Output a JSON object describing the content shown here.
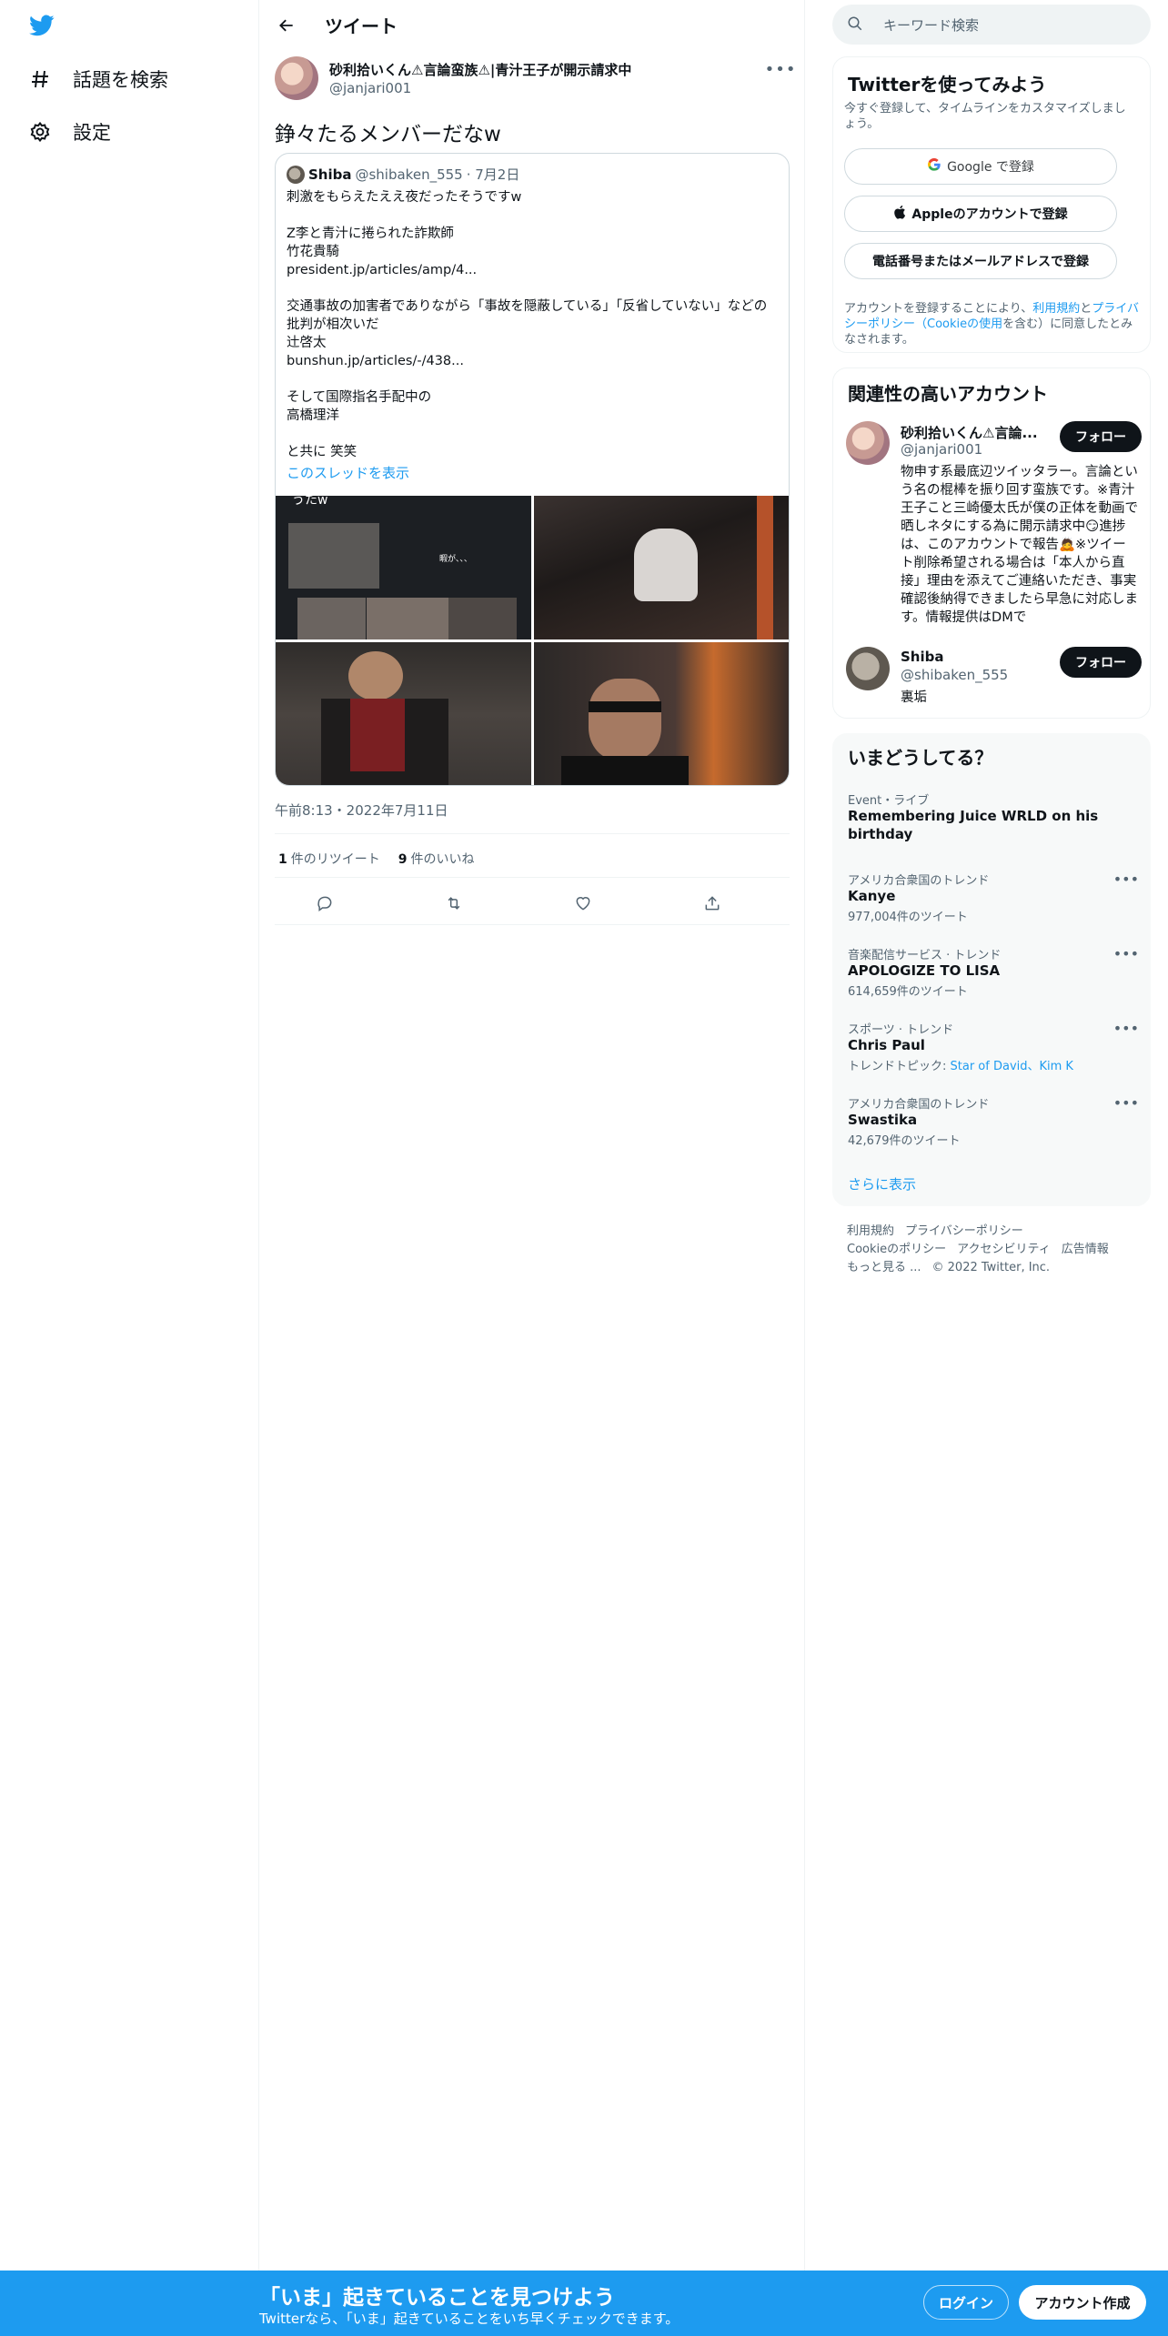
{
  "nav": {
    "items": [
      {
        "label": "話題を検索",
        "icon": "hashtag-icon"
      },
      {
        "label": "設定",
        "icon": "gear-icon"
      }
    ]
  },
  "header": {
    "title": "ツイート"
  },
  "tweet": {
    "author_name": "砂利拾いくん⚠言論蛮族⚠|青汁王子が開示請求中",
    "author_handle": "@janjari001",
    "text": "錚々たるメンバーだなw",
    "timestamp": "午前8:13・2022年7月11日",
    "retweets_count": "1",
    "retweets_label": "件のリツイート",
    "likes_count": "9",
    "likes_label": "件のいいね"
  },
  "quote": {
    "name": "Shiba",
    "handle": "@shibaken_555",
    "date": "· 7月2日",
    "lines": [
      "刺激をもらえたええ夜だったそうですw",
      "",
      "Z李と青汁に捲られた詐欺師",
      "竹花貴騎",
      "president.jp/articles/amp/4...",
      "",
      "交通事故の加害者でありながら「事故を隠蔽している」「反省していない」などの批判が相次いだ",
      "辻啓太",
      "bunshun.jp/articles/-/438...",
      "",
      "そして国際指名手配中の",
      "高橋理洋",
      "",
      "と共に 笑笑"
    ],
    "show_thread": "このスレッドを表示",
    "image1_caption": "うたw",
    "image1_inner": "暇が、、、"
  },
  "search": {
    "placeholder": "キーワード検索"
  },
  "signup_card": {
    "title": "Twitterを使ってみよう",
    "subtitle": "今すぐ登録して、タイムラインをカスタマイズしましょう。",
    "google": "Google で登録",
    "apple": "Appleのアカウントで登録",
    "phone": "電話番号またはメールアドレスで登録",
    "terms_pre": "アカウントを登録することにより、",
    "terms_link1": "利用規約",
    "terms_mid": "と",
    "terms_link2": "プライバシーポリシー（Cookieの使用",
    "terms_post": "を含む）に同意したとみなされます。"
  },
  "related": {
    "title": "関連性の高いアカウント",
    "follow_label": "フォロー",
    "accounts": [
      {
        "name": "砂利拾いくん⚠言論...",
        "handle": "@janjari001",
        "bio": "物申す系最底辺ツイッタラー。言論という名の棍棒を振り回す蛮族です。※青汁王子こと三崎優太氏が僕の正体を動画で晒しネタにする為に開示請求中😏進捗は、このアカウントで報告🙇※ツイート削除希望される場合は「本人から直接」理由を添えてご連絡いただき、事実確認後納得できましたら早急に対応します。情報提供はDMで"
      },
      {
        "name": "Shiba",
        "handle": "@shibaken_555",
        "bio": "裏垢"
      }
    ]
  },
  "trends": {
    "title": "いまどうしてる？",
    "items": [
      {
        "category": "Event・ライブ",
        "name": "Remembering Juice WRLD on his birthday",
        "count": ""
      },
      {
        "category": "アメリカ合衆国のトレンド",
        "name": "Kanye",
        "count": "977,004件のツイート"
      },
      {
        "category": "音楽配信サービス · トレンド",
        "name": "APOLOGIZE TO LISA",
        "count": "614,659件のツイート"
      },
      {
        "category": "スポーツ · トレンド",
        "name": "Chris Paul",
        "count_prefix": "トレンドトピック: ",
        "count_links": "Star of David、Kim K"
      },
      {
        "category": "アメリカ合衆国のトレンド",
        "name": "Swastika",
        "count": "42,679件のツイート"
      }
    ],
    "show_more": "さらに表示"
  },
  "footer": {
    "links": [
      "利用規約",
      "プライバシーポリシー",
      "Cookieのポリシー",
      "アクセシビリティ",
      "広告情報",
      "もっと見る ..."
    ],
    "copyright": "© 2022 Twitter, Inc."
  },
  "bottom_bar": {
    "title": "「いま」起きていることを見つけよう",
    "subtitle": "Twitterなら、「いま」起きていることをいち早くチェックできます。",
    "login": "ログイン",
    "signup": "アカウント作成"
  },
  "colors": {
    "accent": "#1d9bf0",
    "text": "#0f1419",
    "muted": "#536471"
  }
}
